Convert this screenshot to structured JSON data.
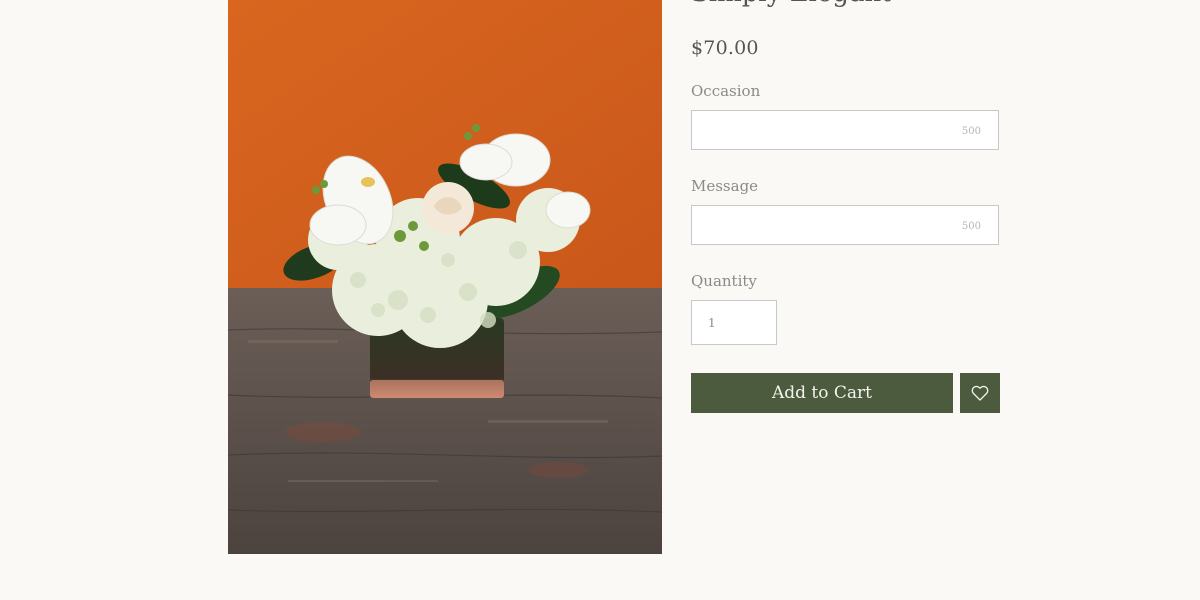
{
  "product": {
    "title": "Simply Elegant",
    "price": "$70.00",
    "image_alt": "White orchid, rose and hydrangea arrangement in a square glass vase"
  },
  "fields": {
    "occasion": {
      "label": "Occasion",
      "value": "",
      "char_limit": "500"
    },
    "message": {
      "label": "Message",
      "value": "",
      "char_limit": "500"
    },
    "quantity": {
      "label": "Quantity",
      "value": "1"
    }
  },
  "actions": {
    "add_to_cart_label": "Add to Cart",
    "wishlist_icon": "heart-icon"
  },
  "colors": {
    "accent": "#4c5a3e",
    "background": "#faf9f5",
    "wall": "#d9661f",
    "table": "#5a4f49"
  }
}
